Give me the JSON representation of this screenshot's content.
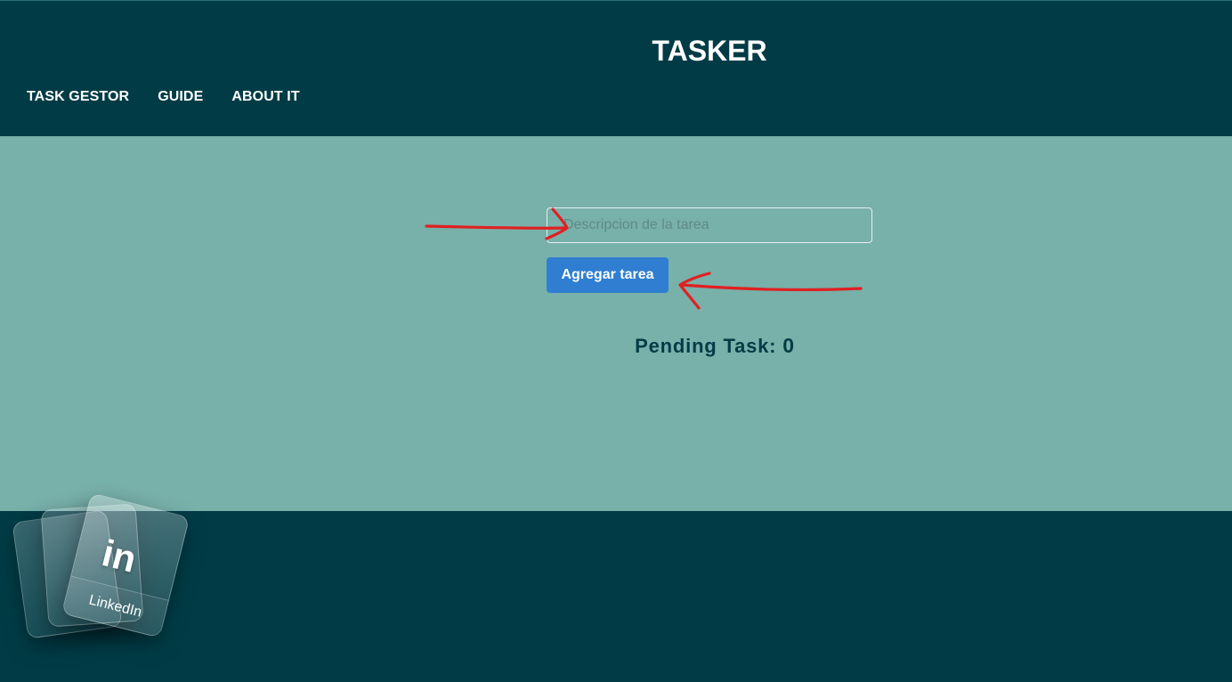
{
  "app": {
    "title": "TASKER"
  },
  "nav": {
    "items": [
      {
        "label": "TASK GESTOR"
      },
      {
        "label": "GUIDE"
      },
      {
        "label": "ABOUT IT"
      }
    ]
  },
  "task_form": {
    "input_placeholder": "Descripcion de la tarea",
    "input_value": "",
    "add_button_label": "Agregar tarea"
  },
  "pending": {
    "label": "Pending Task: ",
    "count": "0"
  },
  "social": {
    "linkedin_logo": "in",
    "linkedin_label": "LinkedIn"
  },
  "colors": {
    "header_bg": "#013c46",
    "main_bg": "#78b0aa",
    "button_bg": "#2f7ed1",
    "annotation_arrow": "#e02020"
  }
}
